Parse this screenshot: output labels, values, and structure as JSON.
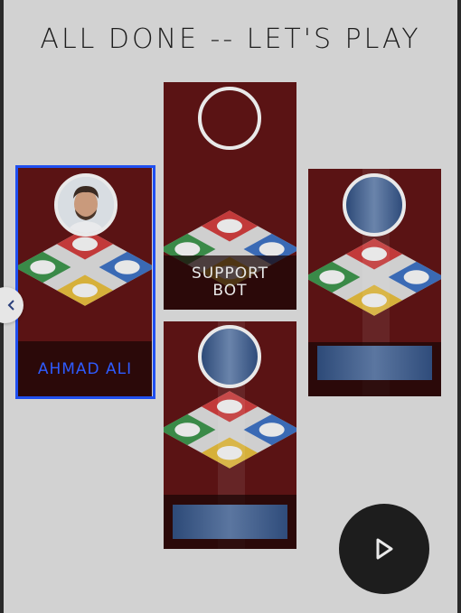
{
  "header": {
    "title": "All Done -- Let's Play"
  },
  "players": [
    {
      "slot": "left",
      "name": "AHMAD ALI",
      "selected": true,
      "avatar": "photo",
      "name_color": "#2e5bff"
    },
    {
      "slot": "top-center",
      "name": "SUPPORT\nBOT",
      "selected": false,
      "avatar": "empty",
      "name_color": "#e8e8e8"
    },
    {
      "slot": "bottom-center",
      "name": "",
      "selected": false,
      "avatar": "placeholder",
      "name_color": ""
    },
    {
      "slot": "right",
      "name": "",
      "selected": false,
      "avatar": "placeholder",
      "name_color": ""
    }
  ],
  "controls": {
    "prev_icon": "chevron-left-icon",
    "play_icon": "play-icon"
  },
  "colors": {
    "selection": "#1f4ff0",
    "panel_bg": "#d2d2d2",
    "play_button": "#1d1d1d",
    "card_bg": "#5a1314"
  }
}
